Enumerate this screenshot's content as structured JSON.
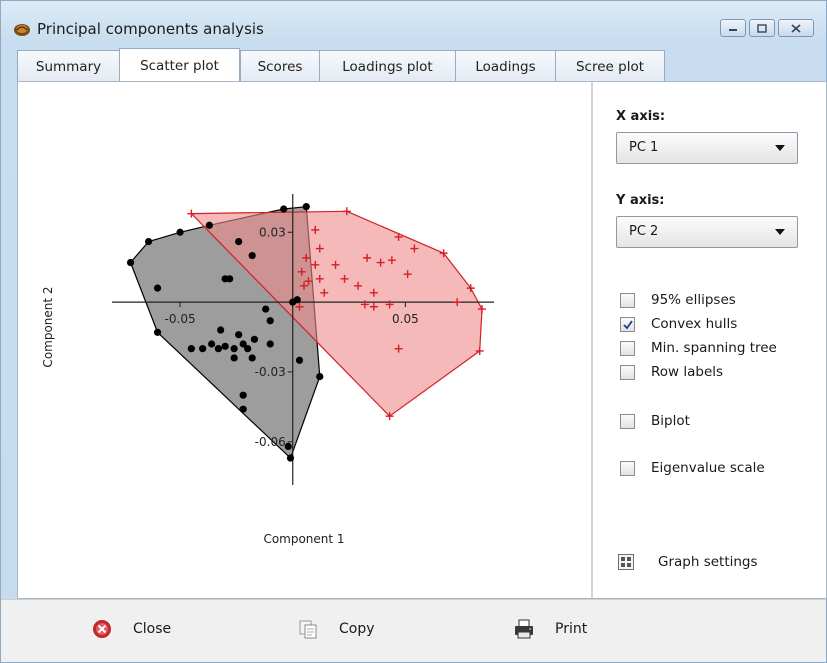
{
  "window": {
    "title": "Principal components analysis",
    "icon": "shell-icon",
    "controls": [
      "minimize",
      "maximize",
      "close"
    ]
  },
  "tabs": [
    {
      "label": "Summary",
      "active": false
    },
    {
      "label": "Scatter plot",
      "active": true
    },
    {
      "label": "Scores",
      "active": false
    },
    {
      "label": "Loadings plot",
      "active": false
    },
    {
      "label": "Loadings",
      "active": false
    },
    {
      "label": "Scree plot",
      "active": false
    }
  ],
  "controls": {
    "x_axis_label": "X axis:",
    "x_axis_value": "PC 1",
    "y_axis_label": "Y axis:",
    "y_axis_value": "PC 2",
    "options": [
      {
        "label": "95% ellipses",
        "checked": false
      },
      {
        "label": "Convex hulls",
        "checked": true
      },
      {
        "label": "Min. spanning tree",
        "checked": false
      },
      {
        "label": "Row labels",
        "checked": false
      },
      {
        "label": "Biplot",
        "checked": false
      },
      {
        "label": "Eigenvalue scale",
        "checked": false
      }
    ],
    "graph_settings": "Graph settings"
  },
  "footer": {
    "close": "Close",
    "copy": "Copy",
    "print": "Print"
  },
  "chart_data": {
    "type": "scatter",
    "xlabel": "Component 1",
    "ylabel": "Component 2",
    "xlim": [
      -0.082,
      0.092
    ],
    "ylim": [
      -0.076,
      0.043
    ],
    "x_ticks": [
      {
        "value": -0.05,
        "label": "-0.05"
      },
      {
        "value": 0.05,
        "label": "0.05"
      }
    ],
    "y_ticks": [
      {
        "value": 0.03,
        "label": "0.03"
      },
      {
        "value": -0.03,
        "label": "-0.03"
      },
      {
        "value": -0.06,
        "label": "-0.06"
      }
    ],
    "convex_hulls": true,
    "series": [
      {
        "marker": "dot",
        "color": "#000000",
        "hull_fill": "#8c8c8c",
        "points": [
          [
            -0.004,
            0.04
          ],
          [
            -0.037,
            0.033
          ],
          [
            -0.05,
            0.03
          ],
          [
            -0.072,
            0.017
          ],
          [
            -0.064,
            0.026
          ],
          [
            -0.06,
            0.006
          ],
          [
            -0.03,
            0.01
          ],
          [
            -0.028,
            0.01
          ],
          [
            -0.024,
            0.026
          ],
          [
            -0.06,
            -0.013
          ],
          [
            -0.018,
            0.02
          ],
          [
            0.0,
            0.0
          ],
          [
            -0.012,
            -0.003
          ],
          [
            -0.01,
            -0.008
          ],
          [
            -0.045,
            -0.02
          ],
          [
            -0.04,
            -0.02
          ],
          [
            -0.036,
            -0.018
          ],
          [
            -0.033,
            -0.02
          ],
          [
            -0.03,
            -0.019
          ],
          [
            -0.026,
            -0.02
          ],
          [
            -0.022,
            -0.018
          ],
          [
            -0.02,
            -0.02
          ],
          [
            -0.017,
            -0.016
          ],
          [
            -0.024,
            -0.014
          ],
          [
            -0.026,
            -0.024
          ],
          [
            -0.018,
            -0.024
          ],
          [
            -0.01,
            -0.018
          ],
          [
            -0.032,
            -0.012
          ],
          [
            0.003,
            -0.025
          ],
          [
            0.012,
            -0.032
          ],
          [
            -0.022,
            -0.04
          ],
          [
            -0.022,
            -0.046
          ],
          [
            -0.002,
            -0.062
          ],
          [
            -0.001,
            -0.067
          ],
          [
            0.002,
            0.001
          ],
          [
            0.006,
            0.041
          ]
        ]
      },
      {
        "marker": "plus",
        "color": "#d61f26",
        "hull_fill": "#ee8a8a",
        "points": [
          [
            -0.045,
            0.038
          ],
          [
            0.024,
            0.039
          ],
          [
            0.047,
            0.028
          ],
          [
            0.067,
            0.021
          ],
          [
            0.079,
            0.006
          ],
          [
            0.084,
            -0.003
          ],
          [
            0.083,
            -0.021
          ],
          [
            0.043,
            -0.049
          ],
          [
            0.01,
            0.031
          ],
          [
            0.012,
            0.023
          ],
          [
            0.01,
            0.016
          ],
          [
            0.019,
            0.016
          ],
          [
            0.006,
            0.019
          ],
          [
            0.007,
            0.009
          ],
          [
            0.012,
            0.01
          ],
          [
            0.005,
            0.007
          ],
          [
            0.033,
            0.019
          ],
          [
            0.039,
            0.017
          ],
          [
            0.044,
            0.018
          ],
          [
            0.054,
            0.023
          ],
          [
            0.023,
            0.01
          ],
          [
            0.029,
            0.007
          ],
          [
            0.036,
            0.004
          ],
          [
            0.051,
            0.012
          ],
          [
            0.073,
            0.0
          ],
          [
            0.036,
            -0.002
          ],
          [
            0.043,
            -0.001
          ],
          [
            0.032,
            -0.001
          ],
          [
            0.047,
            -0.02
          ],
          [
            0.014,
            0.004
          ],
          [
            0.003,
            -0.002
          ],
          [
            0.004,
            0.013
          ]
        ]
      }
    ]
  }
}
